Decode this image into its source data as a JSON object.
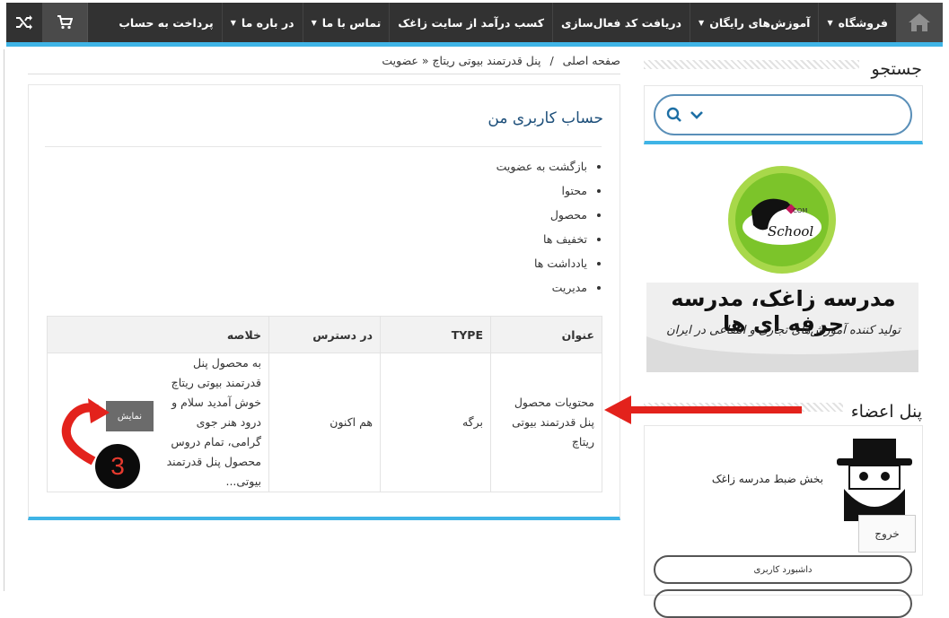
{
  "nav": {
    "items": [
      {
        "label": "فروشگاه",
        "caret": true
      },
      {
        "label": "آموزش‌های رایگان",
        "caret": true
      },
      {
        "label": "دریافت کد فعال‌سازی",
        "caret": false
      },
      {
        "label": "کسب درآمد از سایت زاغک",
        "caret": false
      },
      {
        "label": "تماس با ما",
        "caret": true
      },
      {
        "label": "در باره ما",
        "caret": true
      },
      {
        "label": "پرداخت به حساب",
        "caret": false
      }
    ],
    "home_icon": "home-icon",
    "cart_icon": "cart-icon",
    "shuffle_icon": "shuffle-icon"
  },
  "sidebar": {
    "search_title": "جستجو",
    "logo_caption": "مدرسه زاغک، مدرسه حرفه ای ها",
    "logo_subcaption": "تولید کننده آموزش‌های تجاری و انتفاعی در ایران",
    "logo_badge_text": "School",
    "logo_badge_small": "COM",
    "members_title": "پنل اعضاء",
    "member_text": "بخش ضبط مدرسه زاغک",
    "logout_label": "خروج",
    "dashboard_label": "داشبورد کاربری"
  },
  "breadcrumb": {
    "home": "صفحه اصلی",
    "separator": "/",
    "current": "پنل قدرتمند بیوتی ریتاچ « عضویت"
  },
  "main": {
    "title": "حساب کاربری من",
    "menu": [
      "بازگشت به عضویت",
      "محتوا",
      "محصول",
      "تخفیف ها",
      "یادداشت ها",
      "مدیریت"
    ],
    "table": {
      "headers": [
        "عنوان",
        "TYPE",
        "در دسترس",
        "خلاصه"
      ],
      "row": {
        "title": "محتویات محصول پنل قدرتمند بیوتی ریتاچ",
        "type": "برگه",
        "availability": "هم اکنون",
        "summary": "به محصول پنل قدرتمند بیوتی ریتاچ خوش آمدید سلام و درود هنر جوی گرامی، تمام دروس محصول پنل قدرتمند بیوتی..."
      }
    },
    "show_button": "نمایش",
    "step_number": "3"
  },
  "colors": {
    "nav_bg": "#323232",
    "accent": "#3fb4e6",
    "title_blue": "#1d4f7a",
    "arrow_red": "#e3221c"
  }
}
